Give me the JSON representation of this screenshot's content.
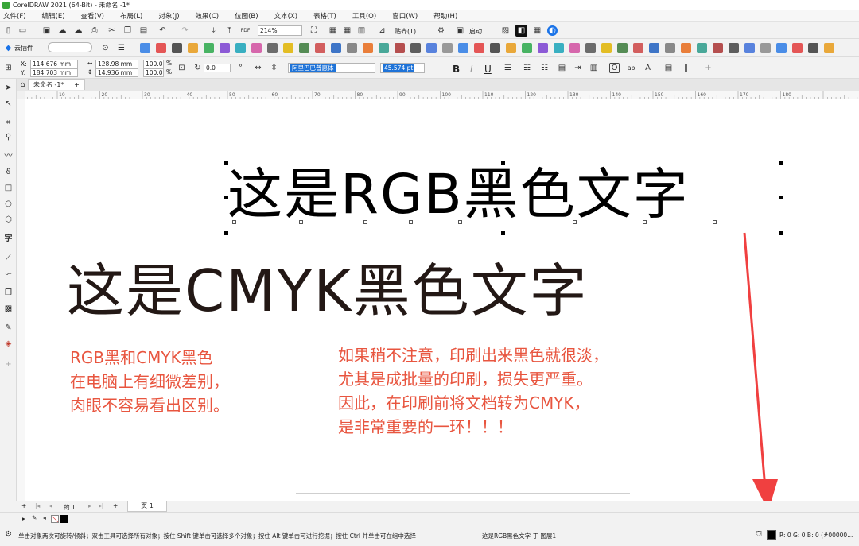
{
  "window": {
    "title": "CorelDRAW 2021 (64-Bit) - 未命名 -1*"
  },
  "menu": [
    "文件(F)",
    "编辑(E)",
    "查看(V)",
    "布局(L)",
    "对象(J)",
    "效果(C)",
    "位图(B)",
    "文本(X)",
    "表格(T)",
    "工具(O)",
    "窗口(W)",
    "帮助(H)"
  ],
  "toolbar1": {
    "zoom": "214%",
    "snap_label": "贴齐(T)",
    "launch_label": "启动"
  },
  "toolbar2": {
    "cloud_plugin": "云插件"
  },
  "property_bar": {
    "x_label": "X:",
    "x_value": "114.676 mm",
    "y_label": "Y:",
    "y_value": "184.703 mm",
    "width_value": "128.98 mm",
    "height_value": "14.936 mm",
    "scale_x": "100.0",
    "scale_y": "100.0",
    "percent": "%",
    "rotation": "0.0",
    "font_name": "阿里巴巴普惠体",
    "font_size": "45.574 pt",
    "bold": "B",
    "italic": "I",
    "underline": "U",
    "abl": "abl"
  },
  "document_tab": {
    "label": "未命名 -1*"
  },
  "ruler_ticks": [
    "10",
    "20",
    "30",
    "40",
    "50",
    "60",
    "70",
    "80",
    "90",
    "100",
    "110",
    "120",
    "130",
    "140",
    "150",
    "160",
    "170",
    "180"
  ],
  "canvas": {
    "rgb_text": "这是RGB黑色文字",
    "cmyk_text": "这是CMYK黑色文字",
    "note_left": [
      "RGB黑和CMYK黑色",
      "在电脑上有细微差别，",
      "肉眼不容易看出区别。"
    ],
    "note_right": [
      "如果稍不注意，印刷出来黑色就很淡，",
      "尤其是成批量的印刷，损失更严重。",
      "因此，在印刷前将文档转为CMYK，",
      "是非常重要的一环！！！"
    ],
    "arrow_color": "#f04040",
    "note_color": "#e8553f"
  },
  "pagebar": {
    "page_count": "1 的 1",
    "page_tab": "页 1"
  },
  "status": {
    "hint": "单击对象两次可旋转/倾斜；双击工具可选择所有对象；按住 Shift 键单击可选择多个对象；按住 Alt 键单击可进行挖掘；按住 Ctrl 并单击可在组中选择",
    "selection": "这是RGB黑色文字 于 图层1",
    "color_info": "R: 0 G: 0 B: 0 (#00000..."
  }
}
